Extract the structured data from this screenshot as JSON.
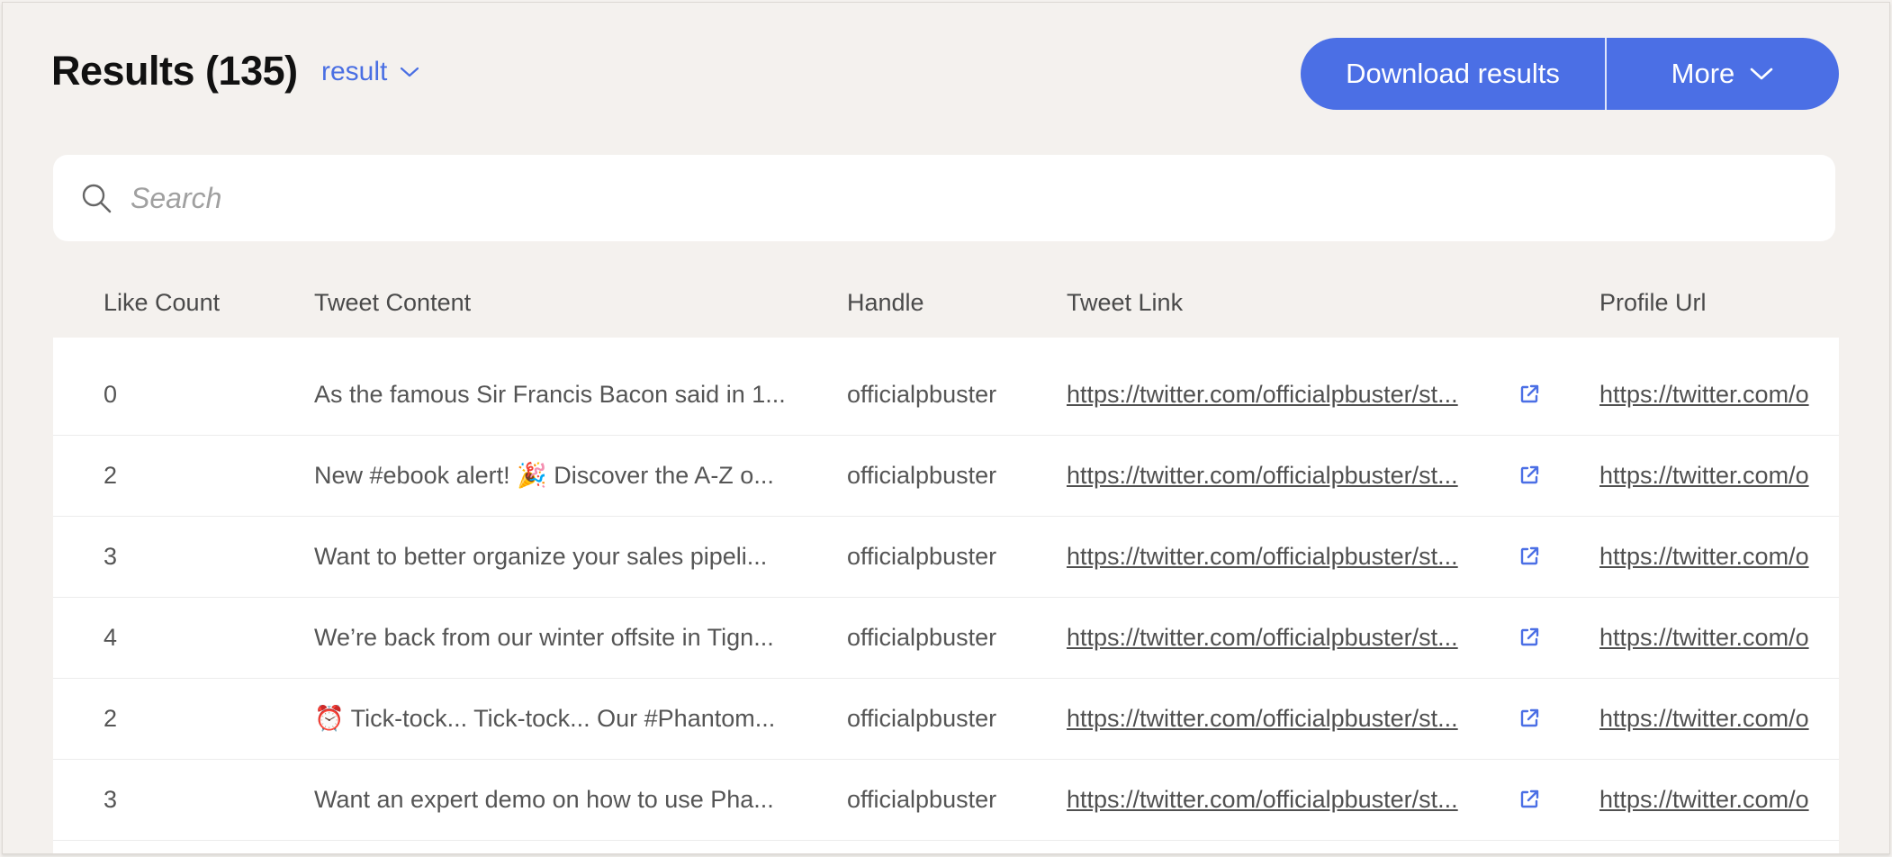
{
  "header": {
    "title": "Results (135)",
    "view_label": "result"
  },
  "actions": {
    "download_label": "Download results",
    "more_label": "More"
  },
  "search": {
    "placeholder": "Search",
    "value": ""
  },
  "table": {
    "columns": {
      "like_count": "Like Count",
      "tweet_content": "Tweet Content",
      "handle": "Handle",
      "tweet_link": "Tweet Link",
      "profile_url": "Profile Url"
    },
    "rows": [
      {
        "like_count": "0",
        "tweet_content": "As the famous Sir Francis Bacon said in 1...",
        "handle": "officialpbuster",
        "tweet_link": "https://twitter.com/officialpbuster/st...",
        "profile_url": "https://twitter.com/o"
      },
      {
        "like_count": "2",
        "tweet_content": "New #ebook alert! 🎉 Discover the A-Z o...",
        "handle": "officialpbuster",
        "tweet_link": "https://twitter.com/officialpbuster/st...",
        "profile_url": "https://twitter.com/o"
      },
      {
        "like_count": "3",
        "tweet_content": "Want to better organize your sales pipeli...",
        "handle": "officialpbuster",
        "tweet_link": "https://twitter.com/officialpbuster/st...",
        "profile_url": "https://twitter.com/o"
      },
      {
        "like_count": "4",
        "tweet_content": "We’re back from our winter offsite in Tign...",
        "handle": "officialpbuster",
        "tweet_link": "https://twitter.com/officialpbuster/st...",
        "profile_url": "https://twitter.com/o"
      },
      {
        "like_count": "2",
        "tweet_content": "⏰ Tick-tock... Tick-tock... Our #Phantom...",
        "handle": "officialpbuster",
        "tweet_link": "https://twitter.com/officialpbuster/st...",
        "profile_url": "https://twitter.com/o"
      },
      {
        "like_count": "3",
        "tweet_content": "Want an expert demo on how to use Pha...",
        "handle": "officialpbuster",
        "tweet_link": "https://twitter.com/officialpbuster/st...",
        "profile_url": "https://twitter.com/o"
      }
    ]
  },
  "colors": {
    "accent": "#4b6fe5",
    "background": "#f4f1ee"
  },
  "icons": {
    "search": "search-icon",
    "chevron": "chevron-down-icon",
    "external_link": "external-link-icon"
  }
}
